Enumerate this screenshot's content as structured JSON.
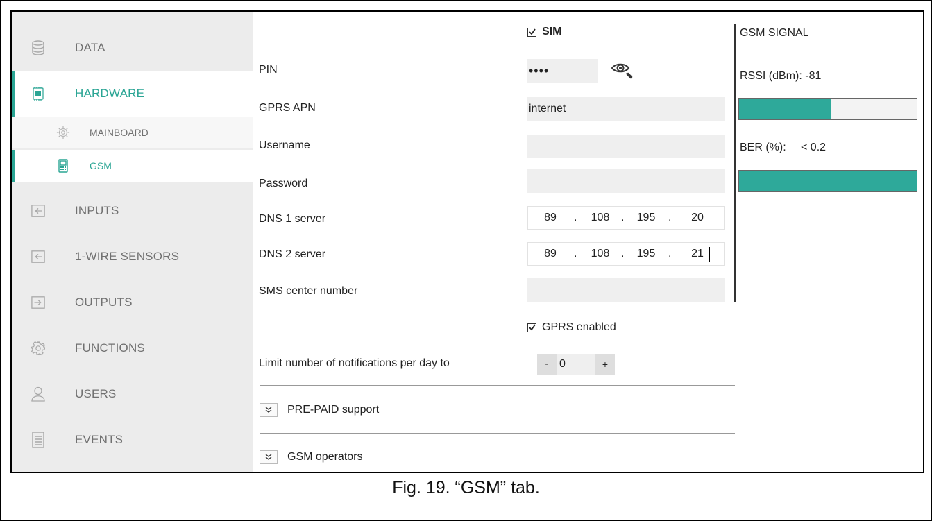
{
  "sidebar": {
    "items": [
      {
        "label": "DATA",
        "icon": "database-icon"
      },
      {
        "label": "HARDWARE",
        "icon": "chip-icon",
        "active": true
      },
      {
        "label": "INPUTS",
        "icon": "input-icon"
      },
      {
        "label": "1-WIRE SENSORS",
        "icon": "input-icon"
      },
      {
        "label": "OUTPUTS",
        "icon": "output-icon"
      },
      {
        "label": "FUNCTIONS",
        "icon": "gear-icon"
      },
      {
        "label": "USERS",
        "icon": "user-icon"
      },
      {
        "label": "EVENTS",
        "icon": "document-icon"
      }
    ],
    "sub_items": [
      {
        "label": "MAINBOARD",
        "icon": "mainboard-icon"
      },
      {
        "label": "GSM",
        "icon": "phone-icon",
        "active": true
      }
    ]
  },
  "form": {
    "sim_label": "SIM",
    "sim_checked": true,
    "pin_label": "PIN",
    "pin_value": "••••",
    "apn_label": "GPRS APN",
    "apn_value": "internet",
    "username_label": "Username",
    "username_value": "",
    "password_label": "Password",
    "password_value": "",
    "dns1_label": "DNS 1 server",
    "dns1": [
      "89",
      "108",
      "195",
      "20"
    ],
    "dns2_label": "DNS 2 server",
    "dns2": [
      "89",
      "108",
      "195",
      "21"
    ],
    "sms_label": "SMS center number",
    "sms_value": "",
    "gprs_label": "GPRS enabled",
    "gprs_checked": true,
    "limit_label": "Limit number of notifications per day to",
    "limit_minus": "-",
    "limit_value": "0",
    "limit_plus": "+",
    "prepaid_label": "PRE-PAID support",
    "operators_label": "GSM operators"
  },
  "signal": {
    "title": "GSM SIGNAL",
    "rssi_label": "RSSI (dBm):",
    "rssi_value": "-81",
    "rssi_fraction": 0.52,
    "ber_label": "BER (%):",
    "ber_value": "< 0.2",
    "ber_fraction": 1.0,
    "bar_color": "#2ea99a"
  },
  "accent_color": "#2aa594",
  "caption": "Fig. 19. “GSM” tab."
}
